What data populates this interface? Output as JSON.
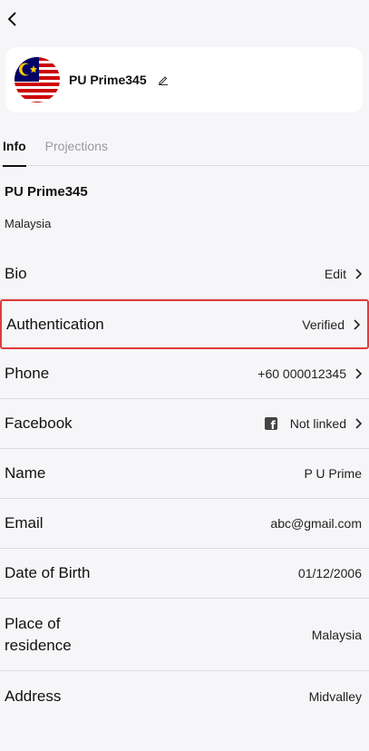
{
  "header": {
    "back_icon": "chevron-left-icon"
  },
  "profile": {
    "name": "PU Prime345",
    "flag_icon": "malaysia-flag-icon",
    "edit_icon": "pencil-icon"
  },
  "tabs": [
    {
      "label": "Info",
      "active": true
    },
    {
      "label": "Projections",
      "active": false
    }
  ],
  "account": {
    "name": "PU Prime345",
    "country": "Malaysia"
  },
  "rows": [
    {
      "label": "Bio",
      "value": "Edit"
    },
    {
      "label": "Authentication",
      "value": "Verified"
    },
    {
      "label": "Phone",
      "value": "+60 000012345"
    },
    {
      "label": "Facebook",
      "value": "Not linked"
    },
    {
      "label": "Name",
      "value": "P U Prime"
    },
    {
      "label": "Email",
      "value": "abc@gmail.com"
    },
    {
      "label": "Date of Birth",
      "value": "01/12/2006"
    },
    {
      "label": "Place of residence",
      "value": "Malaysia"
    },
    {
      "label": "Address",
      "value": "Midvalley"
    }
  ],
  "colors": {
    "highlight": "#e03b3b",
    "card_bg": "#ffffff",
    "page_bg": "#f6f6f8"
  }
}
